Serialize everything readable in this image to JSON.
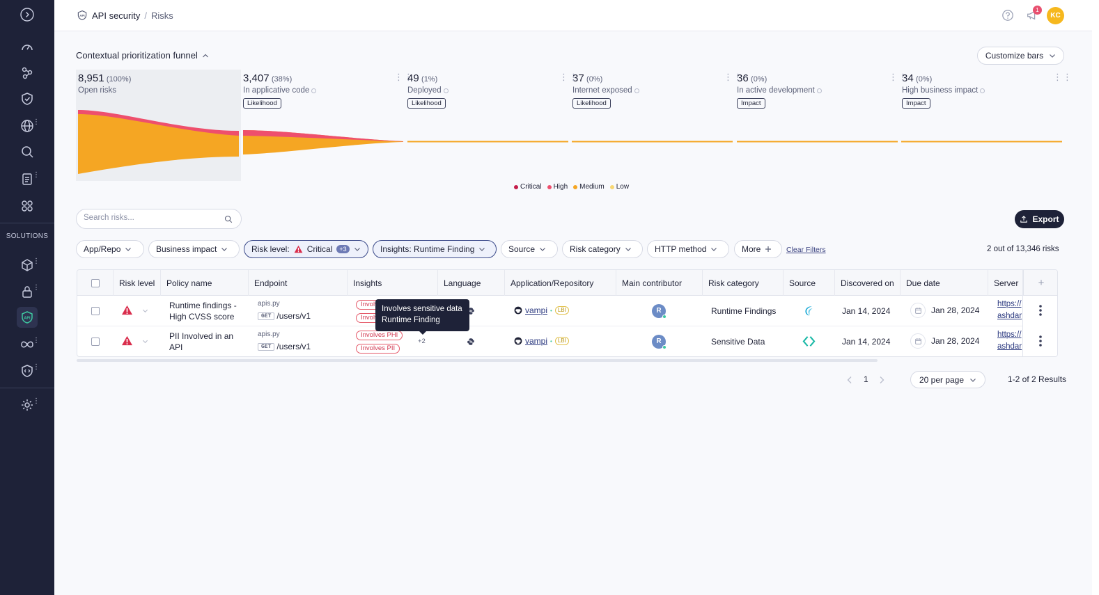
{
  "topbar": {
    "breadcrumb_root": "API security",
    "breadcrumb_current": "Risks",
    "notification_count": "1",
    "user_initials": "KC"
  },
  "sidebar": {
    "solutions_label": "SOLUTIONS"
  },
  "funnel": {
    "title": "Contextual prioritization funnel",
    "customize_label": "Customize bars",
    "stages": [
      {
        "count": "8,951",
        "pct": "(100%)",
        "label": "Open risks",
        "chip": ""
      },
      {
        "count": "3,407",
        "pct": "(38%)",
        "label": "In applicative code",
        "chip": "Likelihood"
      },
      {
        "count": "49",
        "pct": "(1%)",
        "label": "Deployed",
        "chip": "Likelihood"
      },
      {
        "count": "37",
        "pct": "(0%)",
        "label": "Internet exposed",
        "chip": "Likelihood"
      },
      {
        "count": "36",
        "pct": "(0%)",
        "label": "In active development",
        "chip": "Impact"
      },
      {
        "count": "34",
        "pct": "(0%)",
        "label": "High business impact",
        "chip": "Impact"
      }
    ],
    "legend": [
      {
        "name": "Critical",
        "color": "#c41e4a"
      },
      {
        "name": "High",
        "color": "#ee4f6d"
      },
      {
        "name": "Medium",
        "color": "#f5a623"
      },
      {
        "name": "Low",
        "color": "#f7d774"
      }
    ]
  },
  "toolbar": {
    "search_placeholder": "Search risks...",
    "export_label": "Export"
  },
  "filters": {
    "app_repo": "App/Repo",
    "business_impact": "Business impact",
    "risk_level_prefix": "Risk level:",
    "risk_level_value": "Critical",
    "risk_level_extra": "+3",
    "insights": "Insights: Runtime Finding",
    "source": "Source",
    "risk_category": "Risk category",
    "http_method": "HTTP method",
    "more": "More",
    "clear": "Clear Filters",
    "count": "2 out of 13,346 risks"
  },
  "table": {
    "headers": [
      "Risk level",
      "Policy name",
      "Endpoint",
      "Insights",
      "Language",
      "Application/Repository",
      "Main contributor",
      "Risk category",
      "Source",
      "Discovered on",
      "Due date",
      "Server"
    ],
    "rows": [
      {
        "policy_line1": "Runtime findings -",
        "policy_line2": "High CVSS score",
        "file": "apis.py",
        "method": "GET",
        "path": "/users/v1",
        "insight1": "Involves PHI",
        "insight2": "Involves PII",
        "insight_more": "",
        "repo": "vampi",
        "repo_tag": "LBI",
        "contributor": "R",
        "category": "Runtime Findings",
        "discovered": "Jan 14, 2024",
        "due": "Jan 28, 2024",
        "server_1": "https://",
        "server_2": "ashdar"
      },
      {
        "policy_line1": "PII Involved in an",
        "policy_line2": "API",
        "file": "apis.py",
        "method": "GET",
        "path": "/users/v1",
        "insight1": "Involves PHI",
        "insight2": "Involves PII",
        "insight_more": "+2",
        "repo": "vampi",
        "repo_tag": "LBI",
        "contributor": "R",
        "category": "Sensitive Data",
        "discovered": "Jan 14, 2024",
        "due": "Jan 28, 2024",
        "server_1": "https://",
        "server_2": "ashdar"
      }
    ]
  },
  "tooltip": {
    "line1": "Involves sensitive data",
    "line2": "Runtime Finding"
  },
  "pagination": {
    "page": "1",
    "per_page": "20 per page",
    "results": "1-2 of 2 Results"
  }
}
